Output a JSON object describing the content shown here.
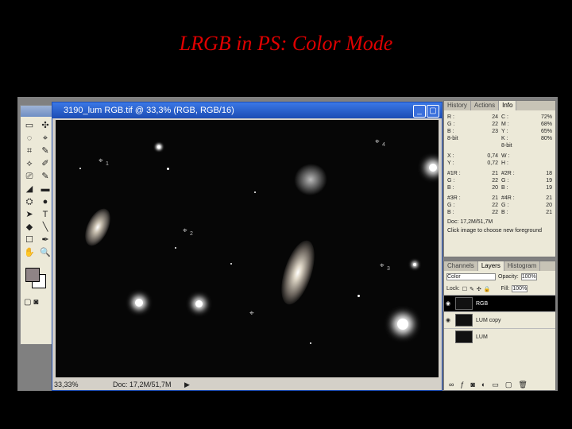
{
  "slide": {
    "title": "LRGB in PS: Color Mode"
  },
  "document": {
    "title": "3190_lum RGB.tif @ 33,3% (RGB, RGB/16)",
    "zoom": "33,33%",
    "status": "Doc: 17,2M/51,7M",
    "markers": [
      "1",
      "2",
      "3",
      "4"
    ]
  },
  "toolbox": {
    "tools": [
      "▭",
      "✣",
      "◌",
      "⌖",
      "⌗",
      "✎",
      "⟡",
      "✐",
      "⎚",
      "✎",
      "◢",
      "▬",
      "⛭",
      "●",
      "➤",
      "T",
      "◆",
      "╲",
      "☐",
      "✒",
      "✋",
      "🔍"
    ]
  },
  "info_panel": {
    "tabs": [
      "History",
      "Actions",
      "Info"
    ],
    "rgb": {
      "r": "24",
      "g": "22",
      "b": "23",
      "mode": "8-bit"
    },
    "cmyk": {
      "c": "72%",
      "m": "68%",
      "y": "65%",
      "k": "80%",
      "mode": "8-bit"
    },
    "xy": {
      "x": "0,74",
      "y": "0,72"
    },
    "wh": {
      "w": "",
      "h": ""
    },
    "s1": {
      "r": "21",
      "g": "22",
      "b": "20"
    },
    "s2": {
      "r": "18",
      "g": "19",
      "b": "19"
    },
    "s3": {
      "r": "21",
      "g": "22",
      "b": "22"
    },
    "s4": {
      "r": "21",
      "g": "20",
      "b": "21"
    },
    "doc": "Doc: 17,2M/51,7M",
    "hint": "Click image to choose new foreground"
  },
  "layers_panel": {
    "tabs": [
      "Channels",
      "Layers",
      "Histogram"
    ],
    "blend_mode": "Color",
    "opacity_label": "Opacity:",
    "opacity": "100%",
    "lock_label": "Lock:",
    "fill_label": "Fill:",
    "fill": "100%",
    "layers": [
      "RGB",
      "LUM copy",
      "LUM"
    ]
  }
}
